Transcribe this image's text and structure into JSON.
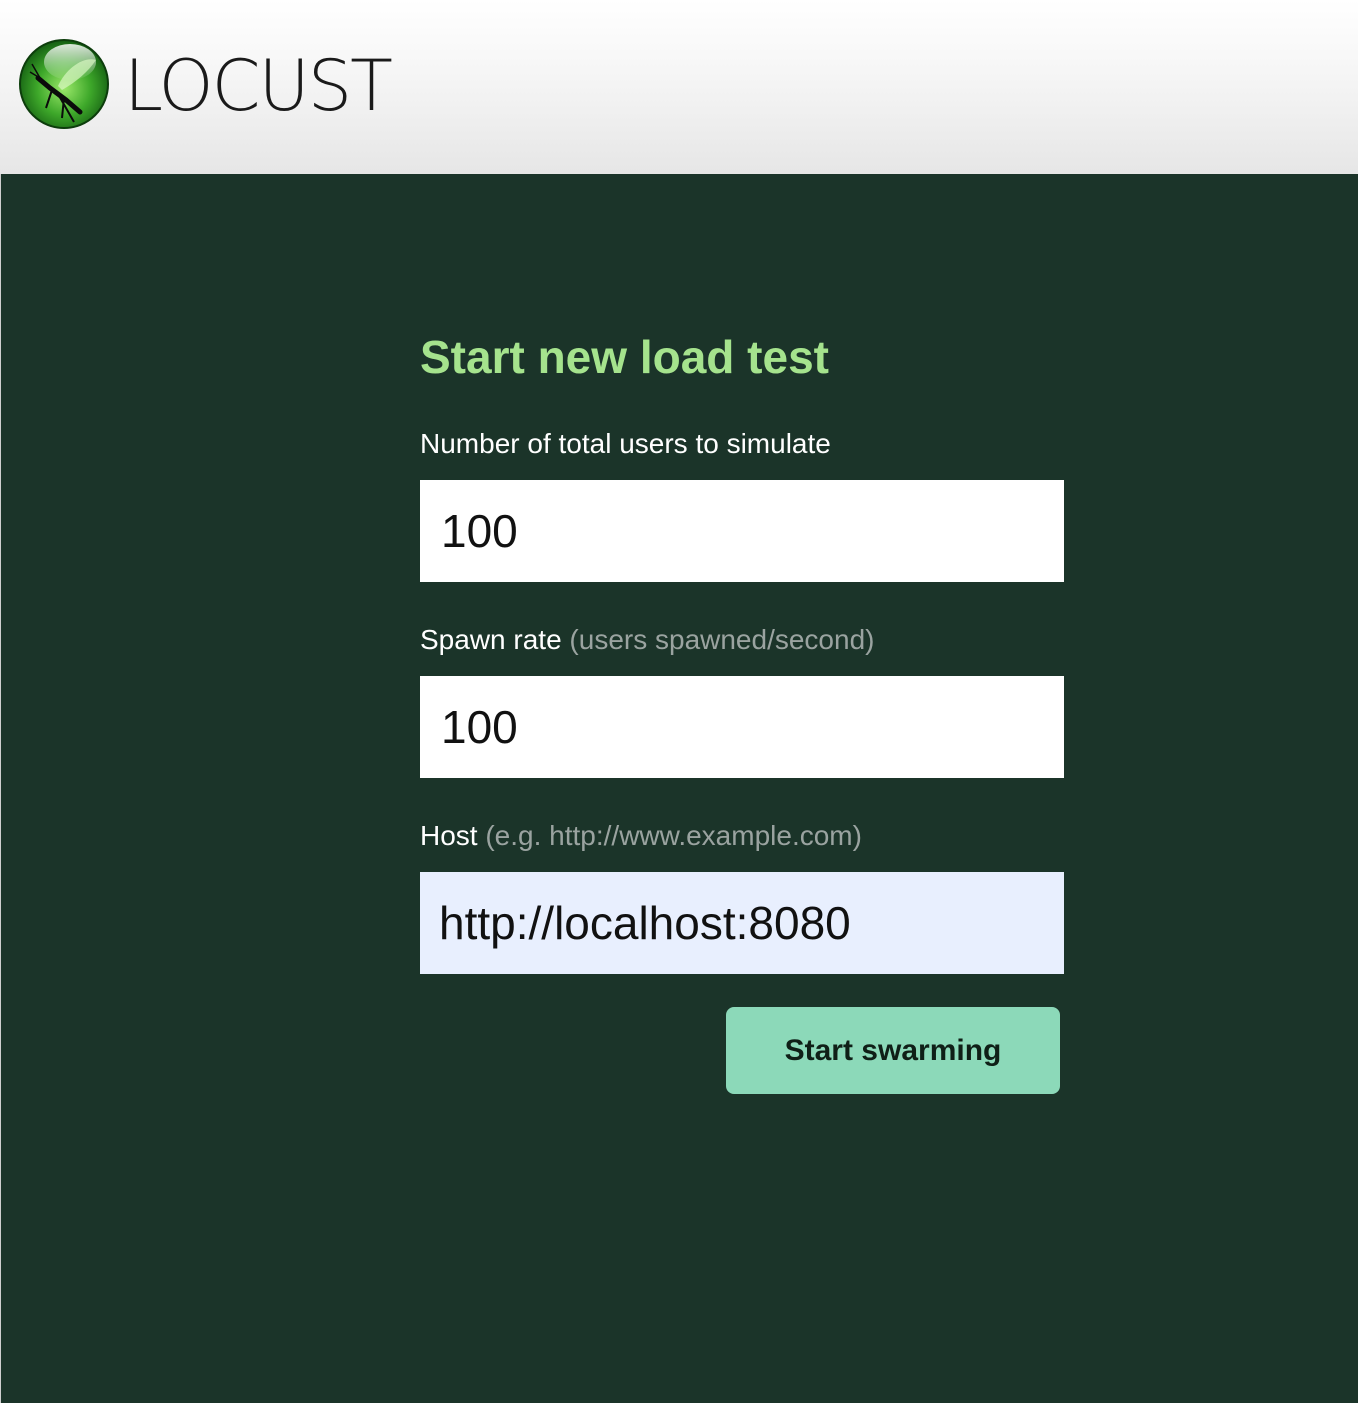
{
  "app": {
    "name": "LOCUST",
    "logo_icon": "locust-logo-icon"
  },
  "form": {
    "title": "Start new load test",
    "users": {
      "label": "Number of total users to simulate",
      "value": "100"
    },
    "spawn_rate": {
      "label": "Spawn rate",
      "hint": "(users spawned/second)",
      "value": "100"
    },
    "host": {
      "label": "Host",
      "hint": "(e.g. http://www.example.com)",
      "value": "http://localhost:8080"
    },
    "submit_label": "Start swarming"
  },
  "colors": {
    "background": "#1b3429",
    "title": "#a5e38d",
    "button": "#8cd9b9",
    "autofill_field": "#e8effe"
  }
}
